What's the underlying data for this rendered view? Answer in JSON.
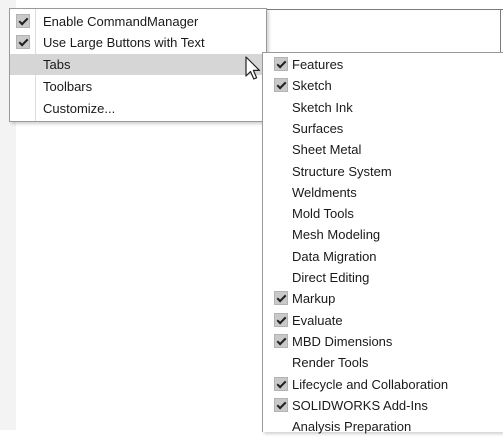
{
  "main_menu": {
    "items": [
      {
        "label": "Enable CommandManager",
        "checked": true
      },
      {
        "label": "Use Large Buttons with Text",
        "checked": true
      },
      {
        "label": "Tabs",
        "checked": false,
        "highlighted": true
      },
      {
        "label": "Toolbars",
        "checked": false
      },
      {
        "label": "Customize...",
        "checked": false
      }
    ]
  },
  "tabs_submenu": {
    "items": [
      {
        "label": "Features",
        "checked": true
      },
      {
        "label": "Sketch",
        "checked": true
      },
      {
        "label": "Sketch Ink",
        "checked": false
      },
      {
        "label": "Surfaces",
        "checked": false
      },
      {
        "label": "Sheet Metal",
        "checked": false
      },
      {
        "label": "Structure System",
        "checked": false
      },
      {
        "label": "Weldments",
        "checked": false
      },
      {
        "label": "Mold Tools",
        "checked": false
      },
      {
        "label": "Mesh Modeling",
        "checked": false
      },
      {
        "label": "Data Migration",
        "checked": false
      },
      {
        "label": "Direct Editing",
        "checked": false
      },
      {
        "label": "Markup",
        "checked": true
      },
      {
        "label": "Evaluate",
        "checked": true
      },
      {
        "label": "MBD Dimensions",
        "checked": true
      },
      {
        "label": "Render Tools",
        "checked": false
      },
      {
        "label": "Lifecycle and Collaboration",
        "checked": true
      },
      {
        "label": "SOLIDWORKS Add-Ins",
        "checked": true
      },
      {
        "label": "Analysis Preparation",
        "checked": false
      }
    ]
  },
  "icons": {
    "check": "checkmark-icon",
    "cursor": "mouse-pointer-icon"
  },
  "colors": {
    "highlight": "#d6d6d6",
    "check_box": "#c9c9c9",
    "border": "#9a9a9a"
  }
}
